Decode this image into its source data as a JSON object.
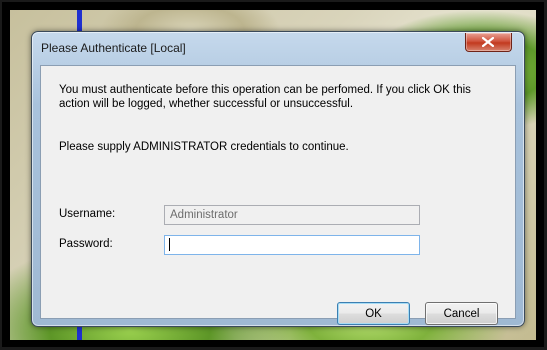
{
  "dialog": {
    "title": "Please Authenticate [Local]",
    "message": "You must authenticate before this operation can be perfomed. If you click OK this action will be logged, whether successful or unsuccessful.",
    "prompt": "Please supply ADMINISTRATOR credentials to continue.",
    "username_label": "Username:",
    "username_value": "Administrator",
    "password_label": "Password:",
    "password_value": "",
    "ok_label": "OK",
    "cancel_label": "Cancel",
    "close_icon": "close-icon"
  },
  "colors": {
    "close_button": "#c2391f",
    "field_focus_border": "#7eb4ea",
    "desktop_stripe": "#1f2fd0"
  }
}
